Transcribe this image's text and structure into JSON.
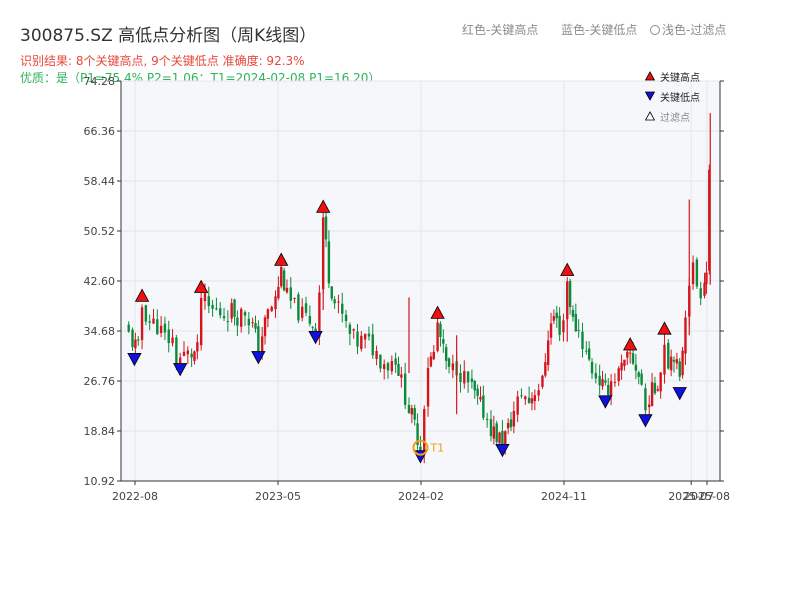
{
  "title": "300875.SZ 高低点分析图（周K线图）",
  "header_legend": {
    "red": "红色-关键高点",
    "blue": "蓝色-关键低点",
    "light": "浅色-过滤点"
  },
  "summary": "识别结果: 8个关键高点, 9个关键低点  准确度: 92.3%",
  "quality": "优质：是（P1=75.4%  P2=1.06：T1=2024-02-08 P1=16.20）",
  "legend": {
    "high": "关键高点",
    "low": "关键低点",
    "filtered": "过滤点"
  },
  "colors": {
    "up": "#d4161c",
    "down": "#0c8a3c",
    "high_marker": "#ee1111",
    "low_marker": "#1111dd",
    "t1": "#f39c12"
  },
  "chart_data": {
    "type": "candlestick",
    "title": "300875.SZ 高低点分析图（周K线图）",
    "y_ticks": [
      10.92,
      18.84,
      26.76,
      34.68,
      42.6,
      50.52,
      58.44,
      66.36,
      74.28
    ],
    "ylim": [
      10.92,
      74.28
    ],
    "x_ticks": [
      "2022-08",
      "2023-05",
      "2024-02",
      "2024-11",
      "2025-07",
      "2025-08"
    ],
    "x_tick_times": [
      2022.583,
      2023.333,
      2024.083,
      2024.833,
      2025.5,
      2025.583
    ],
    "xlim": [
      2022.583,
      2025.6
    ],
    "grid": true,
    "legend_position": "top-right",
    "t1": {
      "label": "T1",
      "date": "2024-02-08",
      "t": 2024.08,
      "price": 16.2
    },
    "key_highs": [
      {
        "t": 2022.62,
        "price": 38.9
      },
      {
        "t": 2022.93,
        "price": 40.3
      },
      {
        "t": 2023.35,
        "price": 44.6
      },
      {
        "t": 2023.57,
        "price": 53.0
      },
      {
        "t": 2024.17,
        "price": 36.2
      },
      {
        "t": 2024.85,
        "price": 43.0
      },
      {
        "t": 2025.18,
        "price": 31.2
      },
      {
        "t": 2025.36,
        "price": 33.7
      }
    ],
    "key_lows": [
      {
        "t": 2022.58,
        "price": 31.6
      },
      {
        "t": 2022.82,
        "price": 30.0
      },
      {
        "t": 2023.23,
        "price": 31.9
      },
      {
        "t": 2023.53,
        "price": 35.1
      },
      {
        "t": 2024.08,
        "price": 16.2
      },
      {
        "t": 2024.51,
        "price": 17.2
      },
      {
        "t": 2025.05,
        "price": 24.9
      },
      {
        "t": 2025.26,
        "price": 21.9
      },
      {
        "t": 2025.44,
        "price": 26.2
      }
    ],
    "path": [
      [
        2022.53,
        35.2
      ],
      [
        2022.57,
        33.0
      ],
      [
        2022.6,
        31.7
      ],
      [
        2022.62,
        38.6
      ],
      [
        2022.66,
        36.2
      ],
      [
        2022.7,
        35.6
      ],
      [
        2022.74,
        33.6
      ],
      [
        2022.78,
        33.2
      ],
      [
        2022.8,
        30.1
      ],
      [
        2022.84,
        30.8
      ],
      [
        2022.88,
        31.0
      ],
      [
        2022.91,
        31.4
      ],
      [
        2022.93,
        40.0
      ],
      [
        2022.97,
        38.2
      ],
      [
        2023.01,
        37.8
      ],
      [
        2023.05,
        37.4
      ],
      [
        2023.09,
        38.0
      ],
      [
        2023.12,
        37.1
      ],
      [
        2023.16,
        37.8
      ],
      [
        2023.2,
        35.5
      ],
      [
        2023.23,
        32.0
      ],
      [
        2023.25,
        34.2
      ],
      [
        2023.28,
        37.5
      ],
      [
        2023.32,
        39.6
      ],
      [
        2023.35,
        44.3
      ],
      [
        2023.38,
        40.0
      ],
      [
        2023.42,
        38.4
      ],
      [
        2023.46,
        37.2
      ],
      [
        2023.5,
        36.4
      ],
      [
        2023.53,
        35.2
      ],
      [
        2023.55,
        41.0
      ],
      [
        2023.57,
        52.8
      ],
      [
        2023.6,
        43.6
      ],
      [
        2023.63,
        39.2
      ],
      [
        2023.67,
        37.0
      ],
      [
        2023.71,
        34.0
      ],
      [
        2023.75,
        32.8
      ],
      [
        2023.79,
        33.4
      ],
      [
        2023.83,
        32.0
      ],
      [
        2023.87,
        30.3
      ],
      [
        2023.91,
        29.4
      ],
      [
        2023.95,
        30.6
      ],
      [
        2023.98,
        26.5
      ],
      [
        2024.02,
        22.4
      ],
      [
        2024.05,
        19.6
      ],
      [
        2024.08,
        16.4
      ],
      [
        2024.1,
        23.5
      ],
      [
        2024.12,
        29.5
      ],
      [
        2024.15,
        31.0
      ],
      [
        2024.17,
        35.8
      ],
      [
        2024.2,
        31.2
      ],
      [
        2024.23,
        28.0
      ],
      [
        2024.27,
        29.1
      ],
      [
        2024.31,
        27.2
      ],
      [
        2024.35,
        25.5
      ],
      [
        2024.38,
        23.4
      ],
      [
        2024.41,
        22.0
      ],
      [
        2024.45,
        19.4
      ],
      [
        2024.48,
        18.0
      ],
      [
        2024.51,
        17.3
      ],
      [
        2024.54,
        19.1
      ],
      [
        2024.57,
        21.8
      ],
      [
        2024.61,
        24.9
      ],
      [
        2024.65,
        23.6
      ],
      [
        2024.68,
        25.4
      ],
      [
        2024.72,
        26.4
      ],
      [
        2024.75,
        34.2
      ],
      [
        2024.78,
        37.0
      ],
      [
        2024.81,
        35.2
      ],
      [
        2024.83,
        36.6
      ],
      [
        2024.85,
        42.6
      ],
      [
        2024.88,
        36.1
      ],
      [
        2024.91,
        34.8
      ],
      [
        2024.95,
        31.0
      ],
      [
        2024.98,
        28.6
      ],
      [
        2025.02,
        26.9
      ],
      [
        2025.05,
        25.0
      ],
      [
        2025.08,
        26.8
      ],
      [
        2025.12,
        28.0
      ],
      [
        2025.15,
        29.1
      ],
      [
        2025.18,
        30.9
      ],
      [
        2025.21,
        29.0
      ],
      [
        2025.24,
        26.1
      ],
      [
        2025.26,
        22.0
      ],
      [
        2025.28,
        24.5
      ],
      [
        2025.31,
        25.5
      ],
      [
        2025.34,
        28.4
      ],
      [
        2025.36,
        33.4
      ],
      [
        2025.38,
        30.0
      ],
      [
        2025.41,
        31.4
      ],
      [
        2025.44,
        26.4
      ],
      [
        2025.47,
        38.0
      ],
      [
        2025.49,
        43.0
      ],
      [
        2025.51,
        44.6
      ],
      [
        2025.53,
        42.0
      ],
      [
        2025.55,
        41.2
      ],
      [
        2025.57,
        43.5
      ],
      [
        2025.58,
        44.1
      ],
      [
        2025.595,
        60.8
      ]
    ]
  }
}
